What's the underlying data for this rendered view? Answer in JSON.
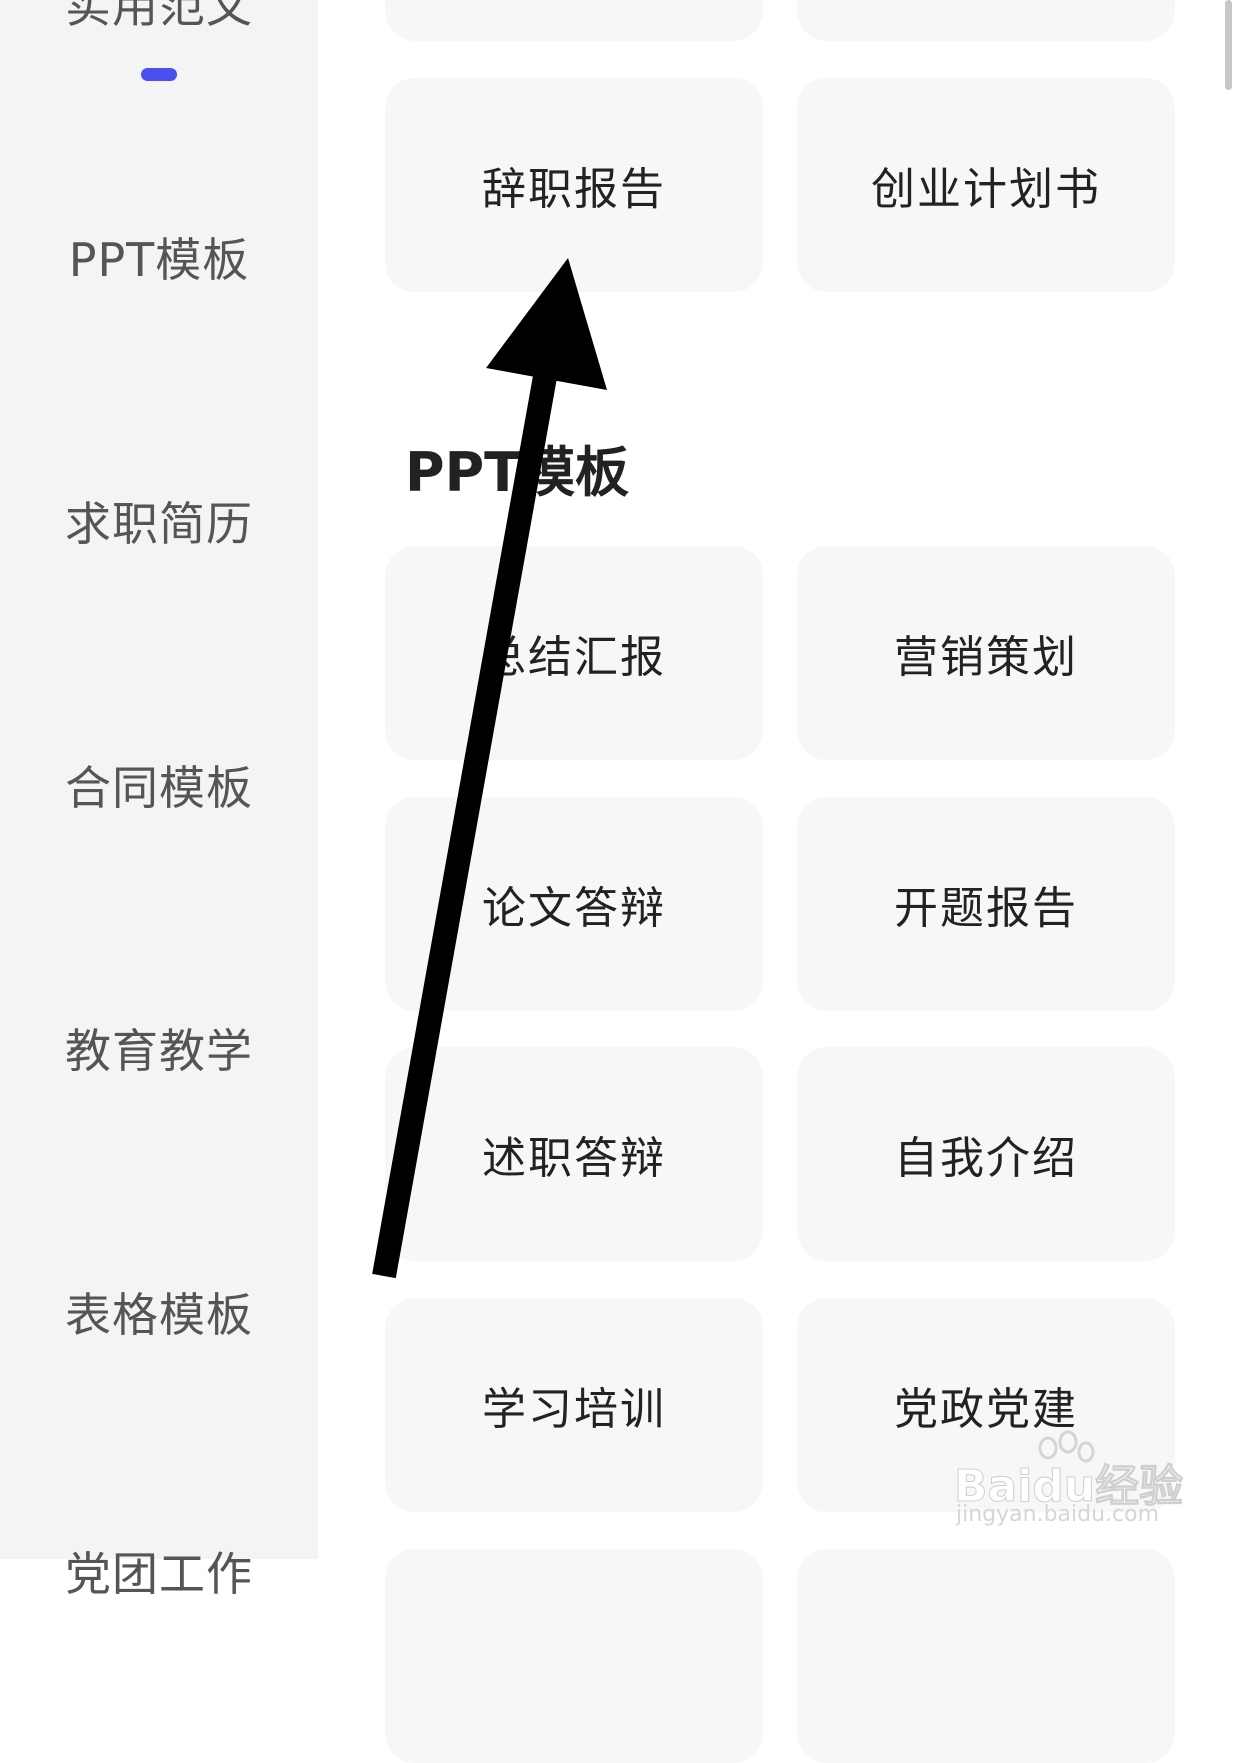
{
  "sidebar": {
    "items": [
      {
        "label": "实用范文"
      },
      {
        "label": "PPT模板"
      },
      {
        "label": "求职简历"
      },
      {
        "label": "合同模板"
      },
      {
        "label": "教育教学"
      },
      {
        "label": "表格模板"
      },
      {
        "label": "党团工作"
      }
    ],
    "active_indicator_color": "#4a4ff0"
  },
  "top_cards": [
    {
      "label": "辞职报告"
    },
    {
      "label": "创业计划书"
    }
  ],
  "ppt_section": {
    "title": "PPT模板",
    "cards": [
      {
        "label": "总结汇报"
      },
      {
        "label": "营销策划"
      },
      {
        "label": "论文答辩"
      },
      {
        "label": "开题报告"
      },
      {
        "label": "述职答辩"
      },
      {
        "label": "自我介绍"
      },
      {
        "label": "学习培训"
      },
      {
        "label": "党政党建"
      }
    ]
  },
  "overlay": {
    "annotation": "arrow-icon"
  },
  "watermark": {
    "brand": "Baidu经验",
    "url": "jingyan.baidu.com"
  }
}
